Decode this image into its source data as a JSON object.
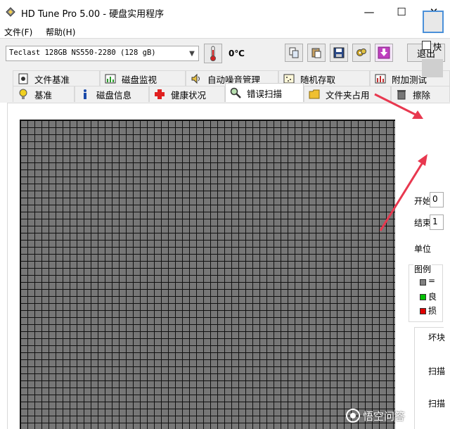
{
  "window": {
    "title": "HD Tune Pro 5.00 - 硬盘实用程序",
    "minimize_glyph": "—",
    "maximize_glyph": "☐",
    "close_glyph": "✕"
  },
  "menu": {
    "items": [
      {
        "label": "文件(F)"
      },
      {
        "label": "帮助(H)"
      }
    ]
  },
  "toolbar": {
    "drive": "Teclast 128GB NS550-2280 (128 gB)",
    "temperature": "0℃",
    "exit_label": "退出",
    "icons": [
      "copy-icon",
      "paste-icon",
      "save-icon",
      "tools-icon",
      "download-icon"
    ]
  },
  "tabs": {
    "row1": [
      {
        "label": "文件基准",
        "icon": "file-benchmark-icon"
      },
      {
        "label": "磁盘监视",
        "icon": "disk-monitor-icon"
      },
      {
        "label": "自动噪音管理",
        "icon": "speaker-icon"
      },
      {
        "label": "随机存取",
        "icon": "random-access-icon"
      },
      {
        "label": "附加测试",
        "icon": "extra-tests-icon"
      }
    ],
    "row2": [
      {
        "label": "基准",
        "icon": "benchmark-icon"
      },
      {
        "label": "磁盘信息",
        "icon": "info-icon"
      },
      {
        "label": "健康状况",
        "icon": "health-cross-icon"
      },
      {
        "label": "错误扫描",
        "icon": "magnifier-icon",
        "active": true
      },
      {
        "label": "文件夹占用",
        "icon": "folder-icon"
      },
      {
        "label": "擦除",
        "icon": "trash-icon"
      }
    ]
  },
  "error_scan": {
    "quick_scan_label": "快",
    "start_label": "开始",
    "start_value": "0",
    "end_label": "结束",
    "end_value": "1",
    "unit_label": "单位",
    "legend_title": "图例",
    "legend": [
      {
        "label": "=",
        "color": "#808080"
      },
      {
        "label": "良",
        "color": "#00c000"
      },
      {
        "label": "损",
        "color": "#e00000"
      }
    ],
    "bad_blocks_label": "坏块",
    "scan_label_1": "扫描",
    "scan_label_2": "扫描"
  },
  "colors": {
    "block_gray": "#777777",
    "arrow_red": "#e8384f",
    "highlight_blue": "#4a90d9"
  },
  "watermark": "悟空问答"
}
